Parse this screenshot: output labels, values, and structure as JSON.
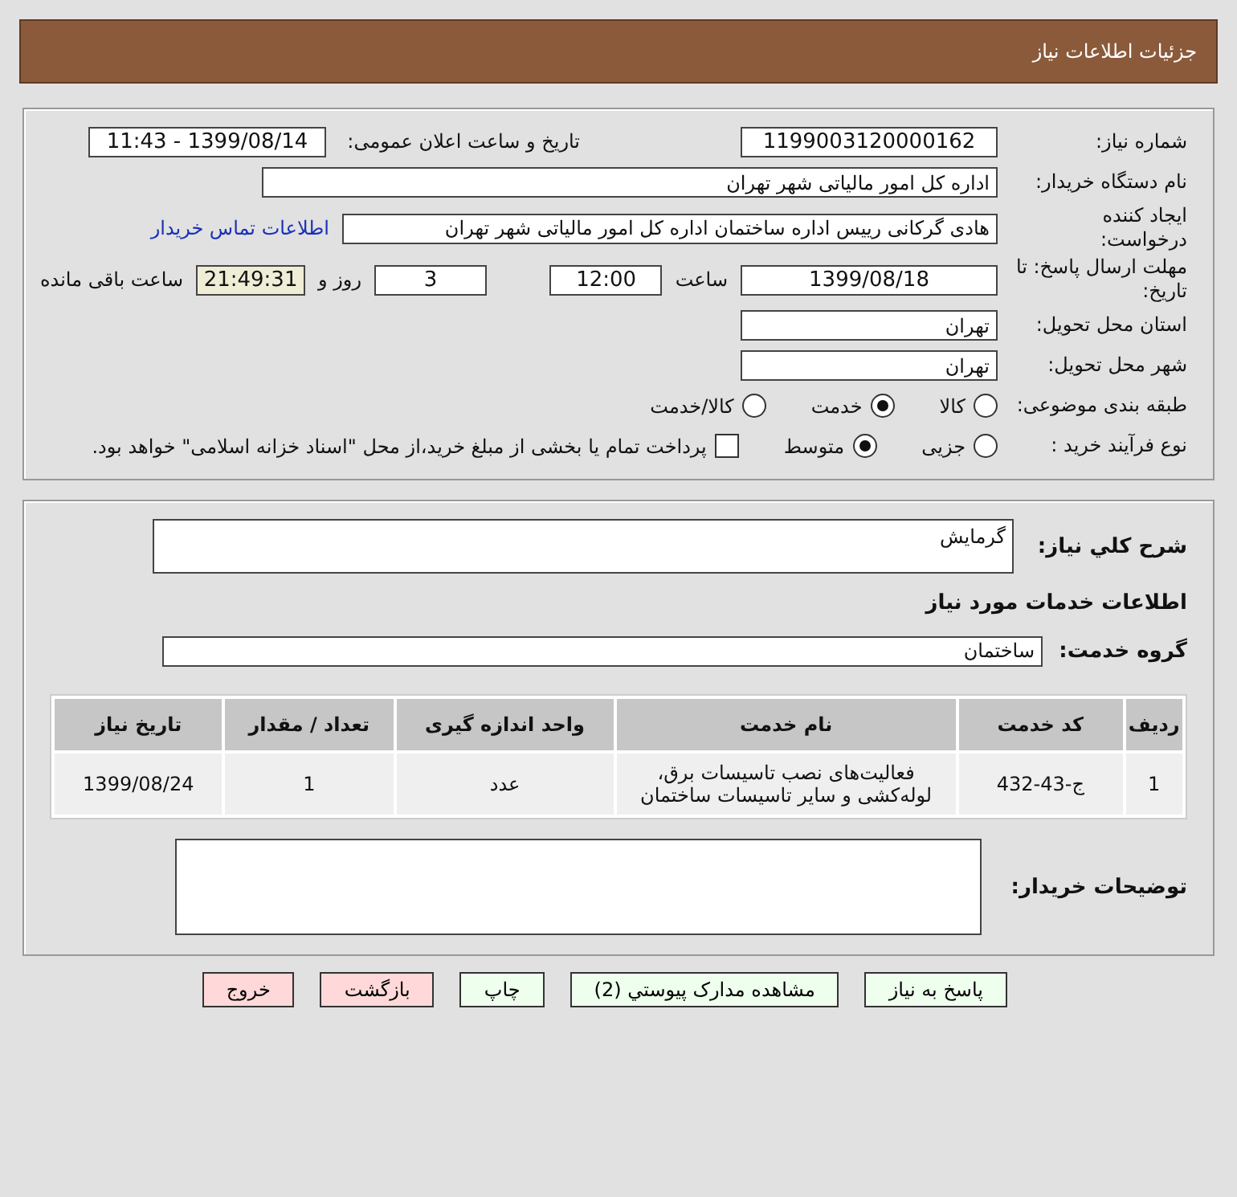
{
  "header": {
    "title": "جزئیات اطلاعات نیاز"
  },
  "need_number": {
    "label": "شماره نیاز:",
    "value": "1199003120000162"
  },
  "announce": {
    "label": "تاریخ و ساعت اعلان عمومی:",
    "value": "1399/08/14 - 11:43"
  },
  "buyer": {
    "label": "نام دستگاه خریدار:",
    "value": "اداره کل امور مالیاتی شهر تهران"
  },
  "creator": {
    "label": "ایجاد کننده درخواست:",
    "value": "هادی گرکانی رییس اداره ساختمان اداره کل امور مالیاتی شهر تهران",
    "link": "اطلاعات تماس خریدار"
  },
  "deadline": {
    "label": "مهلت ارسال پاسخ: تا تاریخ:",
    "date": "1399/08/18",
    "time_label": "ساعت",
    "time": "12:00",
    "days": "3",
    "days_label": "روز و",
    "remaining": "21:49:31",
    "remaining_label": "ساعت باقی مانده"
  },
  "province": {
    "label": "استان محل تحویل:",
    "value": "تهران"
  },
  "city": {
    "label": "شهر محل تحویل:",
    "value": "تهران"
  },
  "category": {
    "label": "طبقه بندی موضوعی:",
    "options": [
      {
        "label": "کالا",
        "selected": false
      },
      {
        "label": "خدمت",
        "selected": true
      },
      {
        "label": "کالا/خدمت",
        "selected": false
      }
    ]
  },
  "process": {
    "label": "نوع فرآیند خرید :",
    "options": [
      {
        "label": "جزیی",
        "selected": false
      },
      {
        "label": "متوسط",
        "selected": true
      }
    ],
    "payment": {
      "label": "پرداخت تمام یا بخشی از مبلغ خرید،از محل \"اسناد خزانه اسلامی\" خواهد بود.",
      "checked": false
    }
  },
  "description": {
    "label": "شرح کلي نیاز:",
    "value": "گرمایش"
  },
  "services_title": "اطلاعات خدمات مورد نیاز",
  "service_group": {
    "label": "گروه خدمت:",
    "value": "ساختمان"
  },
  "table": {
    "columns": [
      "ردیف",
      "کد خدمت",
      "نام خدمت",
      "واحد اندازه گیری",
      "تعداد / مقدار",
      "تاریخ نیاز"
    ],
    "rows": [
      [
        "1",
        "ج-43-432",
        "فعالیت‌های نصب تاسیسات برق، لوله‌کشی و سایر تاسیسات ساختمان",
        "عدد",
        "1",
        "1399/08/24"
      ]
    ]
  },
  "buyer_notes": {
    "label": "توضیحات خریدار:"
  },
  "buttons": [
    {
      "label": "پاسخ به نیاز",
      "kind": "action"
    },
    {
      "label": "مشاهده مدارک پیوستي (2)",
      "kind": "action"
    },
    {
      "label": "چاپ",
      "kind": "action"
    },
    {
      "label": "بازگشت",
      "kind": "exit"
    },
    {
      "label": "خروج",
      "kind": "exit"
    }
  ]
}
